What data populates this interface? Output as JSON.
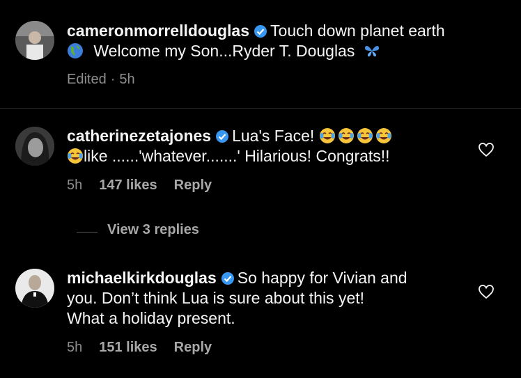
{
  "comments": [
    {
      "username": "cameronmorrelldouglas",
      "text_line1": "Touch down planet earth",
      "text_line2": "Welcome my Son...Ryder T. Douglas",
      "edited": "Edited",
      "sep": "·",
      "time": "5h",
      "emoji_1": "globe-americas-icon",
      "emoji_2": "butterfly-icon"
    },
    {
      "username": "catherinezetajones",
      "text_line1": "Lua's Face!",
      "text_line2": "like ......'whatever.......' Hilarious! Congrats!!",
      "time": "5h",
      "likes": "147 likes",
      "reply": "Reply",
      "emoji": "face-with-tears-of-joy-icon"
    },
    {
      "username": "michaelkirkdouglas",
      "text_line1": "So happy for Vivian and",
      "text_line2": "you. Don’t think Lua is sure about this yet!",
      "text_line3": "What a holiday present.",
      "time": "5h",
      "likes": "151 likes",
      "reply": "Reply"
    }
  ],
  "view_replies": "View 3 replies",
  "colors": {
    "background": "#000000",
    "muted": "#8e8e8e",
    "verified": "#3897f0"
  }
}
